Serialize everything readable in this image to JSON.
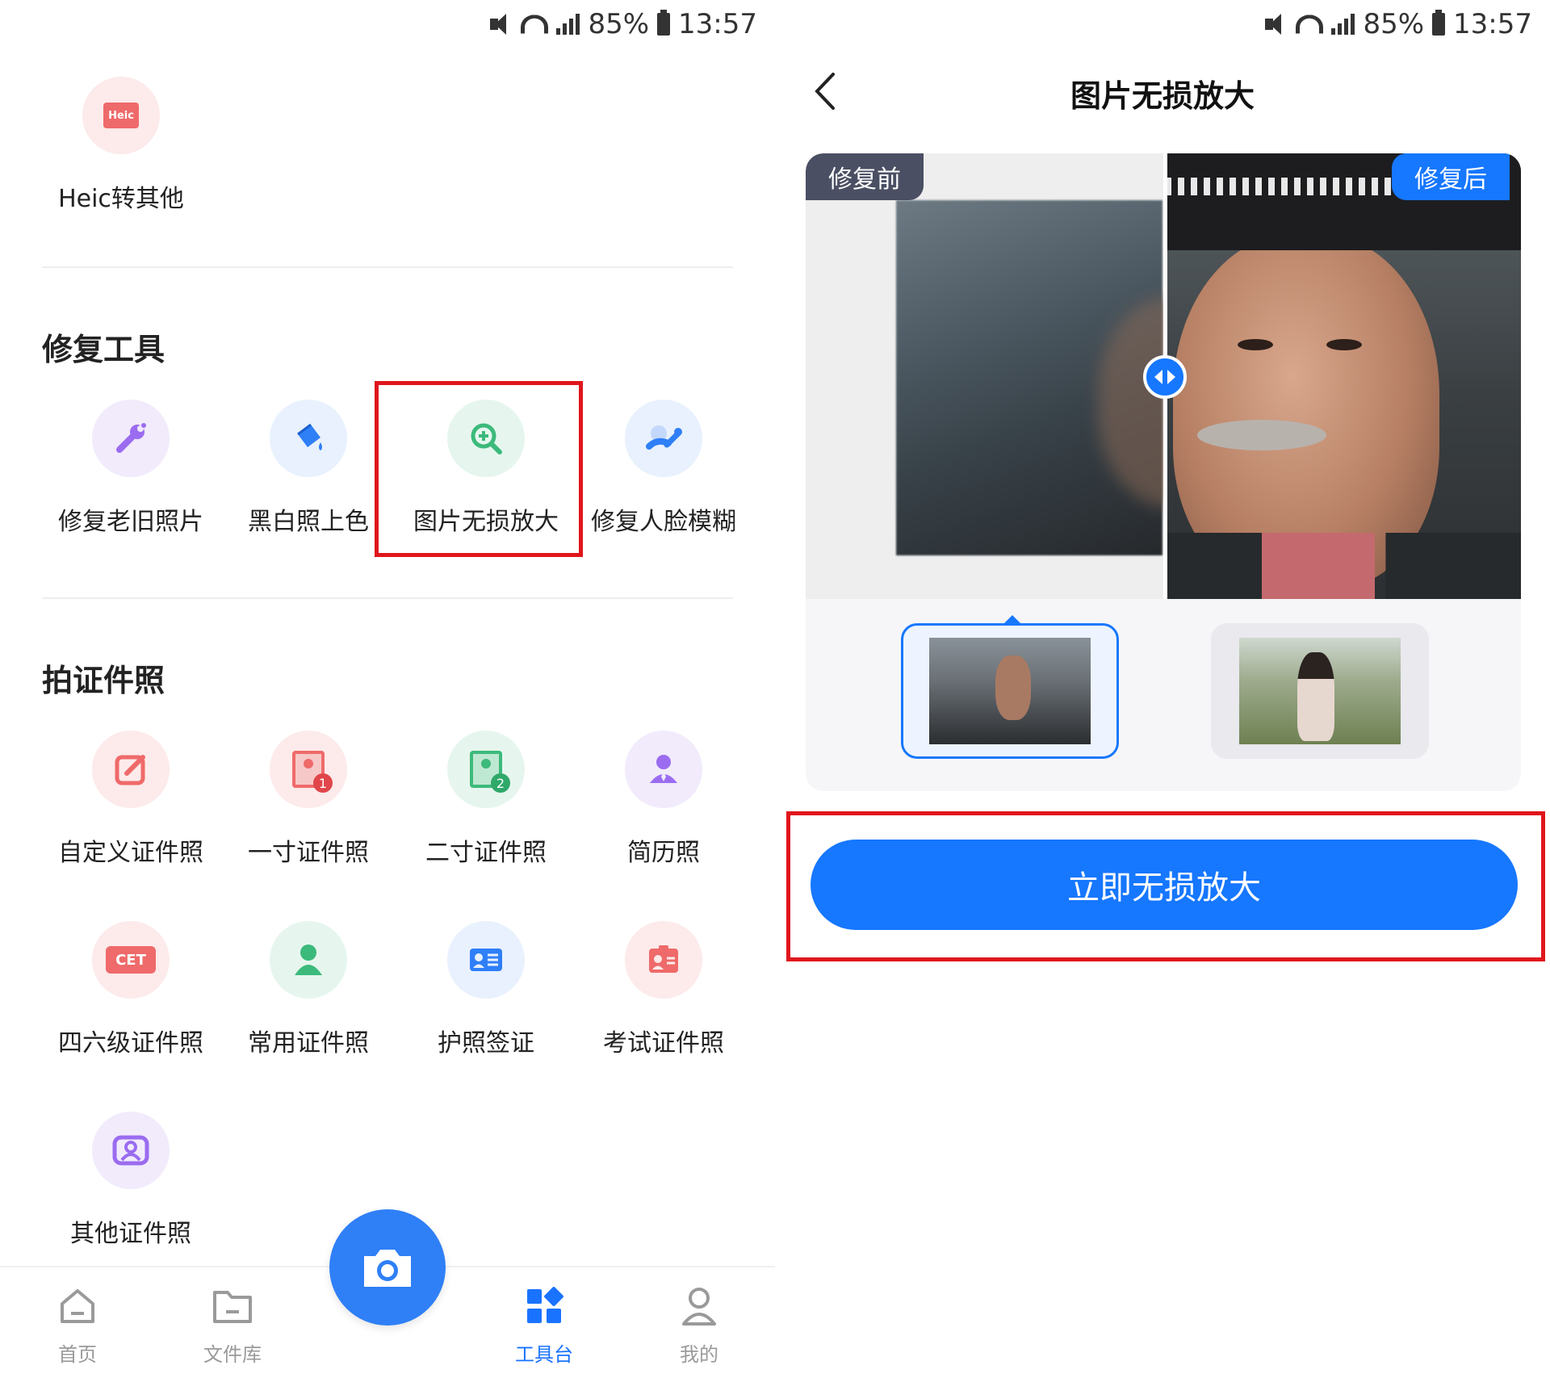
{
  "status_bar": {
    "battery": "85%",
    "time": "13:57"
  },
  "left": {
    "heic": {
      "icon_text": "Heic",
      "label": "Heic转其他"
    },
    "repair_section": {
      "title": "修复工具",
      "items": [
        {
          "label": "修复老旧照片",
          "icon": "wrench-brush-icon"
        },
        {
          "label": "黑白照上色",
          "icon": "paint-bucket-icon"
        },
        {
          "label": "图片无损放大",
          "icon": "zoom-in-icon"
        },
        {
          "label": "修复人脸模糊",
          "icon": "face-repair-icon"
        }
      ]
    },
    "id_section": {
      "title": "拍证件照",
      "items": [
        {
          "label": "自定义证件照",
          "icon": "edit-icon"
        },
        {
          "label": "一寸证件照",
          "icon": "photo-1-icon",
          "badge": "1"
        },
        {
          "label": "二寸证件照",
          "icon": "photo-2-icon",
          "badge": "2"
        },
        {
          "label": "简历照",
          "icon": "person-tie-icon"
        },
        {
          "label": "四六级证件照",
          "icon": "cet-icon",
          "badge": "CET"
        },
        {
          "label": "常用证件照",
          "icon": "person-icon"
        },
        {
          "label": "护照签证",
          "icon": "id-card-icon"
        },
        {
          "label": "考试证件照",
          "icon": "exam-card-icon"
        },
        {
          "label": "其他证件照",
          "icon": "portrait-frame-icon"
        }
      ]
    },
    "nav": [
      {
        "label": "首页",
        "icon": "home-icon"
      },
      {
        "label": "文件库",
        "icon": "folder-icon"
      },
      {
        "label": "工具台",
        "icon": "grid-icon",
        "active": true
      },
      {
        "label": "我的",
        "icon": "user-icon"
      }
    ],
    "colors": {
      "highlight": "#e0161c",
      "accent": "#2f7ff7"
    }
  },
  "right": {
    "title": "图片无损放大",
    "tag_before": "修复前",
    "tag_after": "修复后",
    "cta": "立即无损放大",
    "colors": {
      "primary": "#1677ff"
    }
  }
}
